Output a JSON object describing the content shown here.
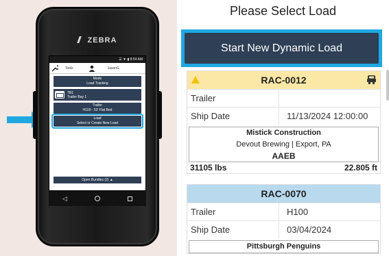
{
  "phone": {
    "brand": "ZEBRA",
    "status_time": "☰ ▼ ▮ 8:54 AM",
    "tools_label": "Tools",
    "user_name": "JasonG",
    "mode": {
      "title": "Mode",
      "value": "Load Tracking"
    },
    "trailer_bay": {
      "code": "TB1",
      "name": "Trailer Bay 1"
    },
    "trailer": {
      "title": "Trailer",
      "value": "H100 - 53' Flat Bed"
    },
    "load": {
      "title": "Load",
      "value": "Select or Create New Load"
    },
    "open_bundles": "Open Bundles (2) ▲",
    "nav": {
      "back": "◁",
      "home": "",
      "recent": ""
    }
  },
  "panel": {
    "title": "Please Select Load",
    "start_button": "Start New Dynamic Load",
    "cards": [
      {
        "id": "RAC-0012",
        "status": "warning",
        "trailer_label": "Trailer",
        "trailer_value": "",
        "ship_label": "Ship Date",
        "ship_value": "11/13/2024 12:00:00",
        "customer": "Mistick Construction",
        "destination": "Devout Brewing | Export, PA",
        "code": "AAEB",
        "weight": "31105 lbs",
        "length": "22.805 ft"
      },
      {
        "id": "RAC-0070",
        "status": "normal",
        "trailer_label": "Trailer",
        "trailer_value": "H100",
        "ship_label": "Ship Date",
        "ship_value": "03/04/2024",
        "customer": "Pittsburgh Penguins"
      }
    ]
  },
  "colors": {
    "accent": "#1fa8e0",
    "button": "#2f3f55",
    "warning_header": "#fbe7a6",
    "normal_header": "#b9d9ef"
  }
}
